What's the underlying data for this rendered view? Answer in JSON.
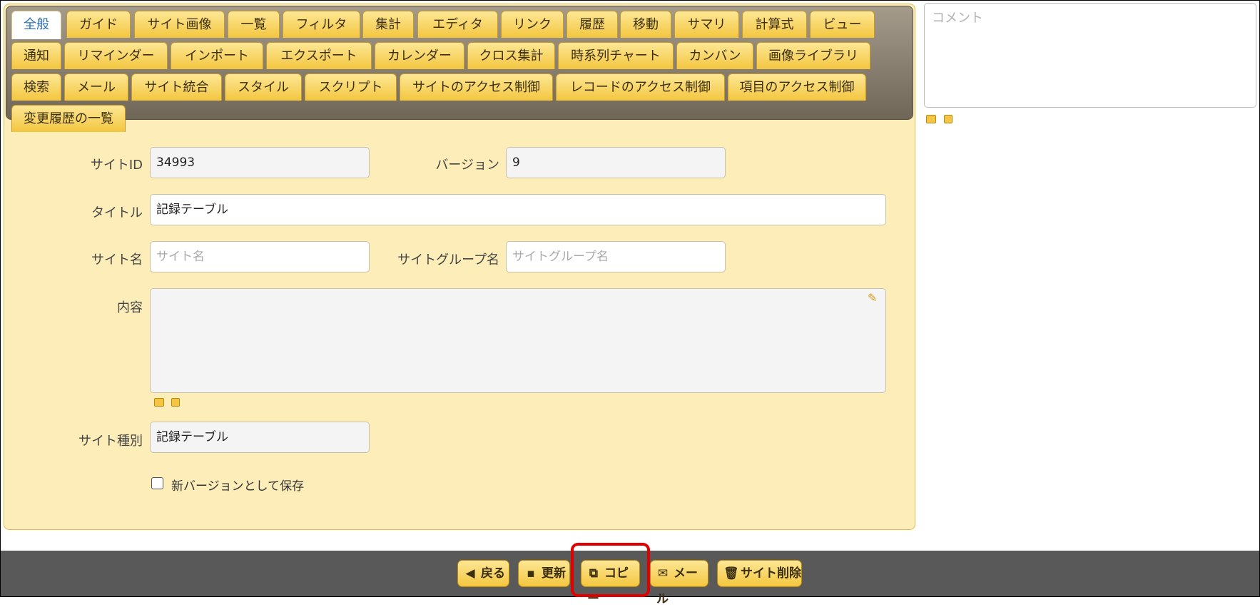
{
  "tabs": {
    "row1": [
      "全般",
      "ガイド",
      "サイト画像",
      "一覧",
      "フィルタ",
      "集計",
      "エディタ",
      "リンク",
      "履歴",
      "移動",
      "サマリ",
      "計算式",
      "ビュー"
    ],
    "row2": [
      "通知",
      "リマインダー",
      "インポート",
      "エクスポート",
      "カレンダー",
      "クロス集計",
      "時系列チャート",
      "カンバン",
      "画像ライブラリ"
    ],
    "row3": [
      "検索",
      "メール",
      "サイト統合",
      "スタイル",
      "スクリプト",
      "サイトのアクセス制御",
      "レコードのアクセス制御",
      "項目のアクセス制御"
    ],
    "row4": [
      "変更履歴の一覧"
    ]
  },
  "form": {
    "site_id_label": "サイトID",
    "site_id_value": "34993",
    "version_label": "バージョン",
    "version_value": "9",
    "title_label": "タイトル",
    "title_value": "記録テーブル",
    "site_name_label": "サイト名",
    "site_name_placeholder": "サイト名",
    "site_group_label": "サイトグループ名",
    "site_group_placeholder": "サイトグループ名",
    "content_label": "内容",
    "site_type_label": "サイト種別",
    "site_type_value": "記録テーブル",
    "new_version_label": "新バージョンとして保存"
  },
  "comment": {
    "placeholder": "コメント"
  },
  "footer": {
    "back": "戻る",
    "update": "更新",
    "copy": "コピー",
    "mail": "メール",
    "delete": "サイト削除"
  },
  "colors": {
    "panel_bg": "#fdeeb9",
    "tab_gold": "#f3c63f",
    "footer_bg": "#595959",
    "highlight": "#e00000"
  }
}
